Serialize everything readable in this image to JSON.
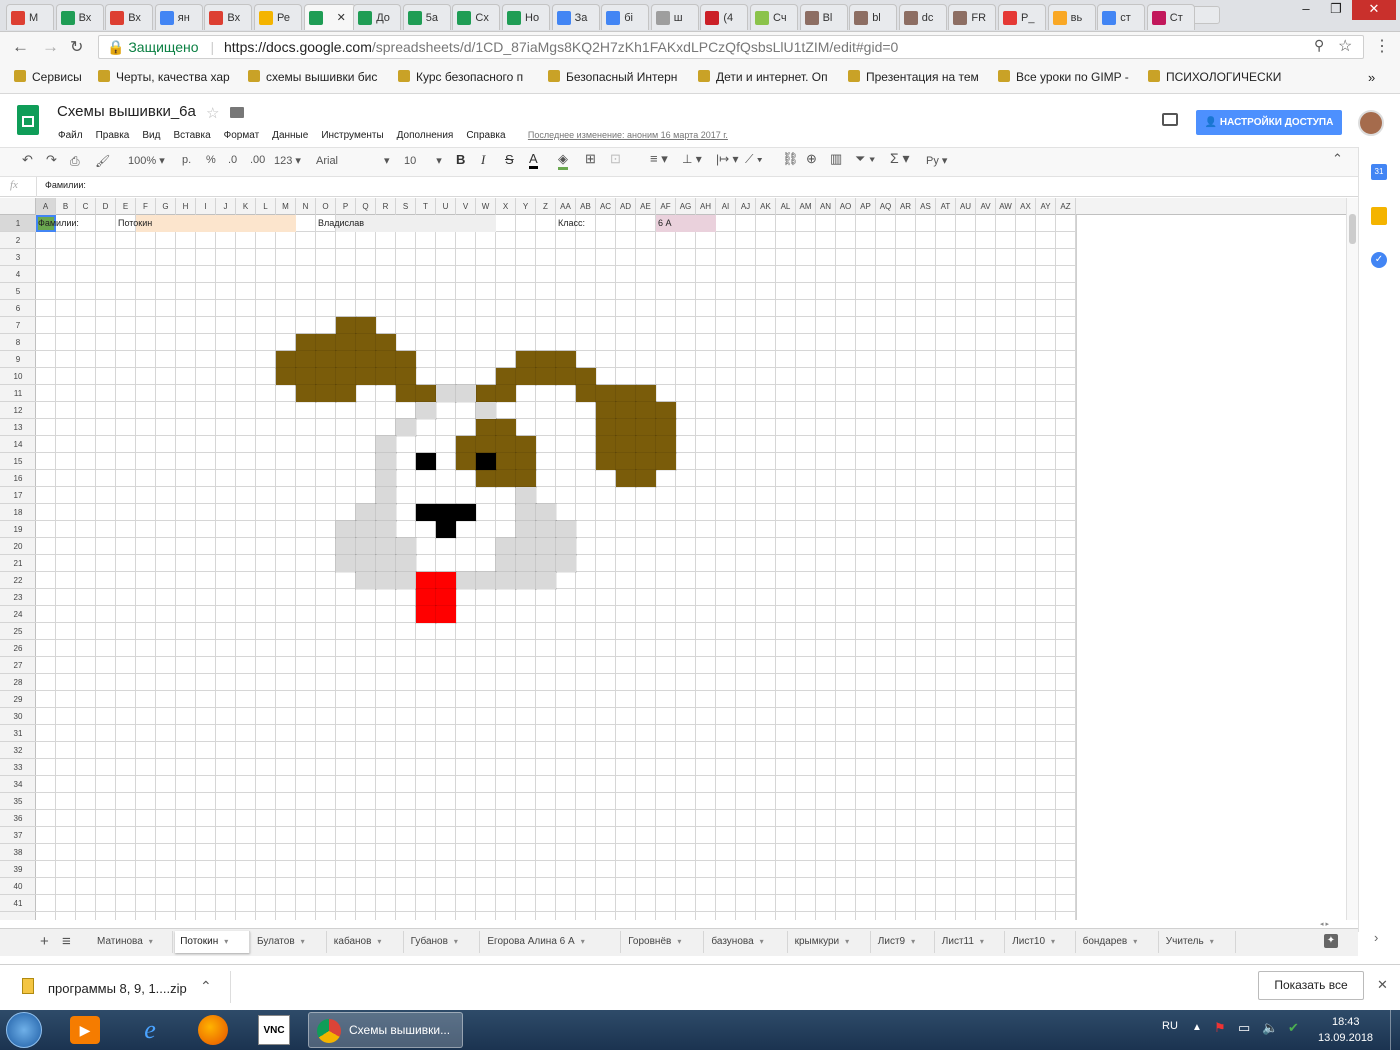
{
  "browser": {
    "tabs": [
      {
        "label": "М",
        "icon": "gmail-icon",
        "color": "#dd3f32"
      },
      {
        "label": "Вх",
        "icon": "sheets-icon",
        "color": "#1f9d55"
      },
      {
        "label": "Вх",
        "icon": "gmail-icon",
        "color": "#dd3f32"
      },
      {
        "label": "ян",
        "icon": "google-icon",
        "color": "#4285f4"
      },
      {
        "label": "Вх",
        "icon": "gmail-icon",
        "color": "#dd3f32"
      },
      {
        "label": "Ре",
        "icon": "drive-icon",
        "color": "#f4b400"
      },
      {
        "label": "",
        "icon": "sheets-icon",
        "color": "#1f9d55"
      },
      {
        "label": "До",
        "icon": "sheets-icon",
        "color": "#1f9d55"
      },
      {
        "label": "5а",
        "icon": "sheets-icon",
        "color": "#1f9d55"
      },
      {
        "label": "Сх",
        "icon": "sheets-icon",
        "color": "#1f9d55"
      },
      {
        "label": "Но",
        "icon": "sheets-icon",
        "color": "#1f9d55"
      },
      {
        "label": "За",
        "icon": "docs-icon",
        "color": "#4285f4"
      },
      {
        "label": "бі",
        "icon": "google-icon",
        "color": "#4285f4"
      },
      {
        "label": "ш",
        "icon": "file-icon",
        "color": "#9e9e9e"
      },
      {
        "label": "(4",
        "icon": "pinterest-icon",
        "color": "#cb2027"
      },
      {
        "label": "Сч",
        "icon": "star-icon",
        "color": "#8bc34a"
      },
      {
        "label": "Bl",
        "icon": "image-icon",
        "color": "#8d6e63"
      },
      {
        "label": "bl",
        "icon": "image-icon",
        "color": "#8d6e63"
      },
      {
        "label": "dc",
        "icon": "image-icon",
        "color": "#8d6e63"
      },
      {
        "label": "FR",
        "icon": "image-icon",
        "color": "#8d6e63"
      },
      {
        "label": "Р_",
        "icon": "photo-icon",
        "color": "#e53935"
      },
      {
        "label": "вь",
        "icon": "lit-icon",
        "color": "#f9a825"
      },
      {
        "label": "ст",
        "icon": "google-icon",
        "color": "#4285f4"
      },
      {
        "label": "Ст",
        "icon": "flower-icon",
        "color": "#c2185b"
      }
    ],
    "active_tab_close": "✕",
    "secure_label": "Защищено",
    "url_host": "https://docs.google.com",
    "url_path": "/spreadsheets/d/1CD_87iaMgs8KQ2H7zKh1FAKxdLPCzQfQsbsLlU1tZIM/edit#gid=0",
    "bookmarks": [
      {
        "label": "Сервисы",
        "icon": "apps-icon"
      },
      {
        "label": "Черты, качества хар",
        "icon": "sun-icon"
      },
      {
        "label": "схемы вышивки бис",
        "icon": "google-icon"
      },
      {
        "label": "Курс безопасного п",
        "icon": "bird-icon"
      },
      {
        "label": "Безопасный Интерн",
        "icon": "page-icon"
      },
      {
        "label": "Дети и интернет. Оп",
        "icon": "shield-icon"
      },
      {
        "label": "Презентация на тем",
        "icon": "presentation-icon"
      },
      {
        "label": "Все уроки по GIMP -",
        "icon": "gimp-icon"
      },
      {
        "label": "ПСИХОЛОГИЧЕСКИ",
        "icon": "book-icon"
      }
    ],
    "more_bookmarks": "»"
  },
  "doc": {
    "title": "Схемы вышивки_6а",
    "menu": [
      "Файл",
      "Правка",
      "Вид",
      "Вставка",
      "Формат",
      "Данные",
      "Инструменты",
      "Дополнения",
      "Справка"
    ],
    "last_edit": "Последнее изменение: аноним 16 марта 2017 г.",
    "share_button": "НАСТРОЙКИ ДОСТУПА"
  },
  "toolbar": {
    "zoom": "100%",
    "currency": "р.",
    "percent": "%",
    "dec_less": ".0",
    "dec_more": ".00",
    "more_formats": "123",
    "font": "Arial",
    "font_size": "10",
    "bold": "B",
    "italic": "I",
    "strike": "S",
    "text_color": "A",
    "input_tools": "Ру"
  },
  "formula_bar": {
    "fx": "fx",
    "value": "Фамилии:"
  },
  "columns": [
    "A",
    "B",
    "C",
    "D",
    "E",
    "F",
    "G",
    "H",
    "I",
    "J",
    "K",
    "L",
    "M",
    "N",
    "O",
    "P",
    "Q",
    "R",
    "S",
    "T",
    "U",
    "V",
    "W",
    "X",
    "Y",
    "Z",
    "AA",
    "AB",
    "AC",
    "AD",
    "AE",
    "AF",
    "AG",
    "AH",
    "AI",
    "AJ",
    "AK",
    "AL",
    "AM",
    "AN",
    "AO",
    "AP",
    "AQ",
    "AR",
    "AS",
    "AT",
    "AU",
    "AV",
    "AW",
    "AX",
    "AY",
    "AZ"
  ],
  "rows": [
    "1",
    "2",
    "3",
    "4",
    "5",
    "6",
    "7",
    "8",
    "9",
    "10",
    "11",
    "12",
    "13",
    "14",
    "15",
    "16",
    "17",
    "18",
    "19",
    "20",
    "21",
    "22",
    "23",
    "24",
    "25",
    "26",
    "27",
    "28",
    "29",
    "30",
    "31",
    "32",
    "33",
    "34",
    "35",
    "36",
    "37",
    "38",
    "39",
    "40",
    "41"
  ],
  "cells": {
    "a1": "Фамилии:",
    "e1": "Потокин",
    "o1": "Владислав",
    "aa1": "Класс:",
    "af1": "6 А"
  },
  "pixel_art": {
    "colors": {
      "brown": "#7a5c0a",
      "grey": "#d9d9d9",
      "black": "#000000",
      "red": "#ff0000"
    },
    "brown": [
      [
        "P",
        7
      ],
      [
        "Q",
        7
      ],
      [
        "N",
        8
      ],
      [
        "O",
        8
      ],
      [
        "P",
        8
      ],
      [
        "Q",
        8
      ],
      [
        "R",
        8
      ],
      [
        "M",
        9
      ],
      [
        "N",
        9
      ],
      [
        "O",
        9
      ],
      [
        "P",
        9
      ],
      [
        "Q",
        9
      ],
      [
        "R",
        9
      ],
      [
        "S",
        9
      ],
      [
        "Y",
        9
      ],
      [
        "Z",
        9
      ],
      [
        "AA",
        9
      ],
      [
        "M",
        10
      ],
      [
        "N",
        10
      ],
      [
        "O",
        10
      ],
      [
        "P",
        10
      ],
      [
        "Q",
        10
      ],
      [
        "R",
        10
      ],
      [
        "S",
        10
      ],
      [
        "X",
        10
      ],
      [
        "Y",
        10
      ],
      [
        "Z",
        10
      ],
      [
        "AA",
        10
      ],
      [
        "AB",
        10
      ],
      [
        "N",
        11
      ],
      [
        "O",
        11
      ],
      [
        "P",
        11
      ],
      [
        "S",
        11
      ],
      [
        "T",
        11
      ],
      [
        "W",
        11
      ],
      [
        "X",
        11
      ],
      [
        "AB",
        11
      ],
      [
        "AC",
        11
      ],
      [
        "AD",
        11
      ],
      [
        "AE",
        11
      ],
      [
        "AC",
        12
      ],
      [
        "AD",
        12
      ],
      [
        "AE",
        12
      ],
      [
        "AF",
        12
      ],
      [
        "W",
        13
      ],
      [
        "X",
        13
      ],
      [
        "AC",
        13
      ],
      [
        "AD",
        13
      ],
      [
        "AE",
        13
      ],
      [
        "AF",
        13
      ],
      [
        "V",
        14
      ],
      [
        "W",
        14
      ],
      [
        "X",
        14
      ],
      [
        "Y",
        14
      ],
      [
        "AC",
        14
      ],
      [
        "AD",
        14
      ],
      [
        "AE",
        14
      ],
      [
        "AF",
        14
      ],
      [
        "V",
        15
      ],
      [
        "W",
        15
      ],
      [
        "X",
        15
      ],
      [
        "Y",
        15
      ],
      [
        "AC",
        15
      ],
      [
        "AD",
        15
      ],
      [
        "AE",
        15
      ],
      [
        "AF",
        15
      ],
      [
        "W",
        16
      ],
      [
        "X",
        16
      ],
      [
        "Y",
        16
      ],
      [
        "AD",
        16
      ],
      [
        "AE",
        16
      ]
    ],
    "grey": [
      [
        "U",
        11
      ],
      [
        "V",
        11
      ],
      [
        "T",
        12
      ],
      [
        "W",
        12
      ],
      [
        "S",
        13
      ],
      [
        "R",
        14
      ],
      [
        "R",
        15
      ],
      [
        "R",
        16
      ],
      [
        "R",
        17
      ],
      [
        "Y",
        17
      ],
      [
        "Q",
        18
      ],
      [
        "R",
        18
      ],
      [
        "Y",
        18
      ],
      [
        "Z",
        18
      ],
      [
        "P",
        19
      ],
      [
        "Q",
        19
      ],
      [
        "R",
        19
      ],
      [
        "Y",
        19
      ],
      [
        "Z",
        19
      ],
      [
        "AA",
        19
      ],
      [
        "P",
        20
      ],
      [
        "Q",
        20
      ],
      [
        "R",
        20
      ],
      [
        "S",
        20
      ],
      [
        "X",
        20
      ],
      [
        "Y",
        20
      ],
      [
        "Z",
        20
      ],
      [
        "AA",
        20
      ],
      [
        "P",
        21
      ],
      [
        "Q",
        21
      ],
      [
        "R",
        21
      ],
      [
        "S",
        21
      ],
      [
        "X",
        21
      ],
      [
        "Y",
        21
      ],
      [
        "Z",
        21
      ],
      [
        "AA",
        21
      ],
      [
        "Q",
        22
      ],
      [
        "R",
        22
      ],
      [
        "S",
        22
      ],
      [
        "V",
        22
      ],
      [
        "W",
        22
      ],
      [
        "X",
        22
      ],
      [
        "Y",
        22
      ],
      [
        "Z",
        22
      ]
    ],
    "black": [
      [
        "T",
        15
      ],
      [
        "W",
        15
      ],
      [
        "T",
        18
      ],
      [
        "U",
        18
      ],
      [
        "V",
        18
      ],
      [
        "U",
        19
      ]
    ],
    "red": [
      [
        "T",
        22
      ],
      [
        "U",
        22
      ],
      [
        "T",
        23
      ],
      [
        "U",
        23
      ],
      [
        "T",
        24
      ],
      [
        "U",
        24
      ]
    ]
  },
  "sheets": [
    "Матинова",
    "Потокин",
    "Булатов",
    "кабанов",
    "Губанов",
    "Егорова Алина 6 А",
    "Горовнёв",
    "базунова",
    "крымкури",
    "Лист9",
    "Лист11",
    "Лист10",
    "бондарев",
    "Учитель"
  ],
  "active_sheet": "Потокин",
  "download": {
    "file": "программы 8, 9, 1....zip",
    "show_all": "Показать все"
  },
  "taskbar": {
    "window_title": "Схемы вышивки...",
    "lang": "RU",
    "time": "18:43",
    "date": "13.09.2018"
  }
}
